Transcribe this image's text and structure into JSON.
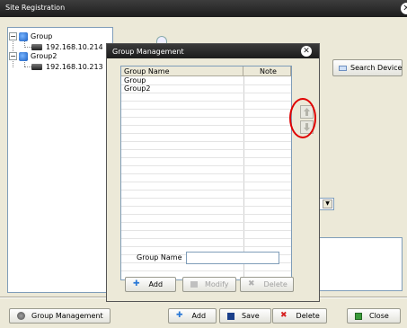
{
  "window": {
    "title": "Site Registration"
  },
  "tree": {
    "nodes": [
      {
        "label": "Group",
        "toggle": "−"
      },
      {
        "label": "192.168.10.214"
      },
      {
        "label": "Group2",
        "toggle": "−"
      },
      {
        "label": "192.168.10.213"
      }
    ]
  },
  "search_device_label": "Search Device",
  "bottom_bar": {
    "group_management_label": "Group Management",
    "add_label": "Add",
    "save_label": "Save",
    "delete_label": "Delete",
    "close_label": "Close"
  },
  "modal": {
    "title": "Group Management",
    "columns": [
      "Group Name",
      "Note"
    ],
    "rows": [
      {
        "name": "Group",
        "note": ""
      },
      {
        "name": "Group2",
        "note": ""
      }
    ],
    "group_name_label": "Group Name",
    "group_name_value": "",
    "add_label": "Add",
    "modify_label": "Modify",
    "delete_label": "Delete"
  },
  "colors": {
    "title_bar": "#1d1d1d",
    "highlight": "#e00000",
    "panel": "#ece9d8"
  },
  "icons": [
    "close-icon",
    "group-icon",
    "dvr-icon",
    "search-icon",
    "move-up-icon",
    "move-down-icon",
    "add-icon",
    "save-icon",
    "delete-icon",
    "close-icon"
  ]
}
